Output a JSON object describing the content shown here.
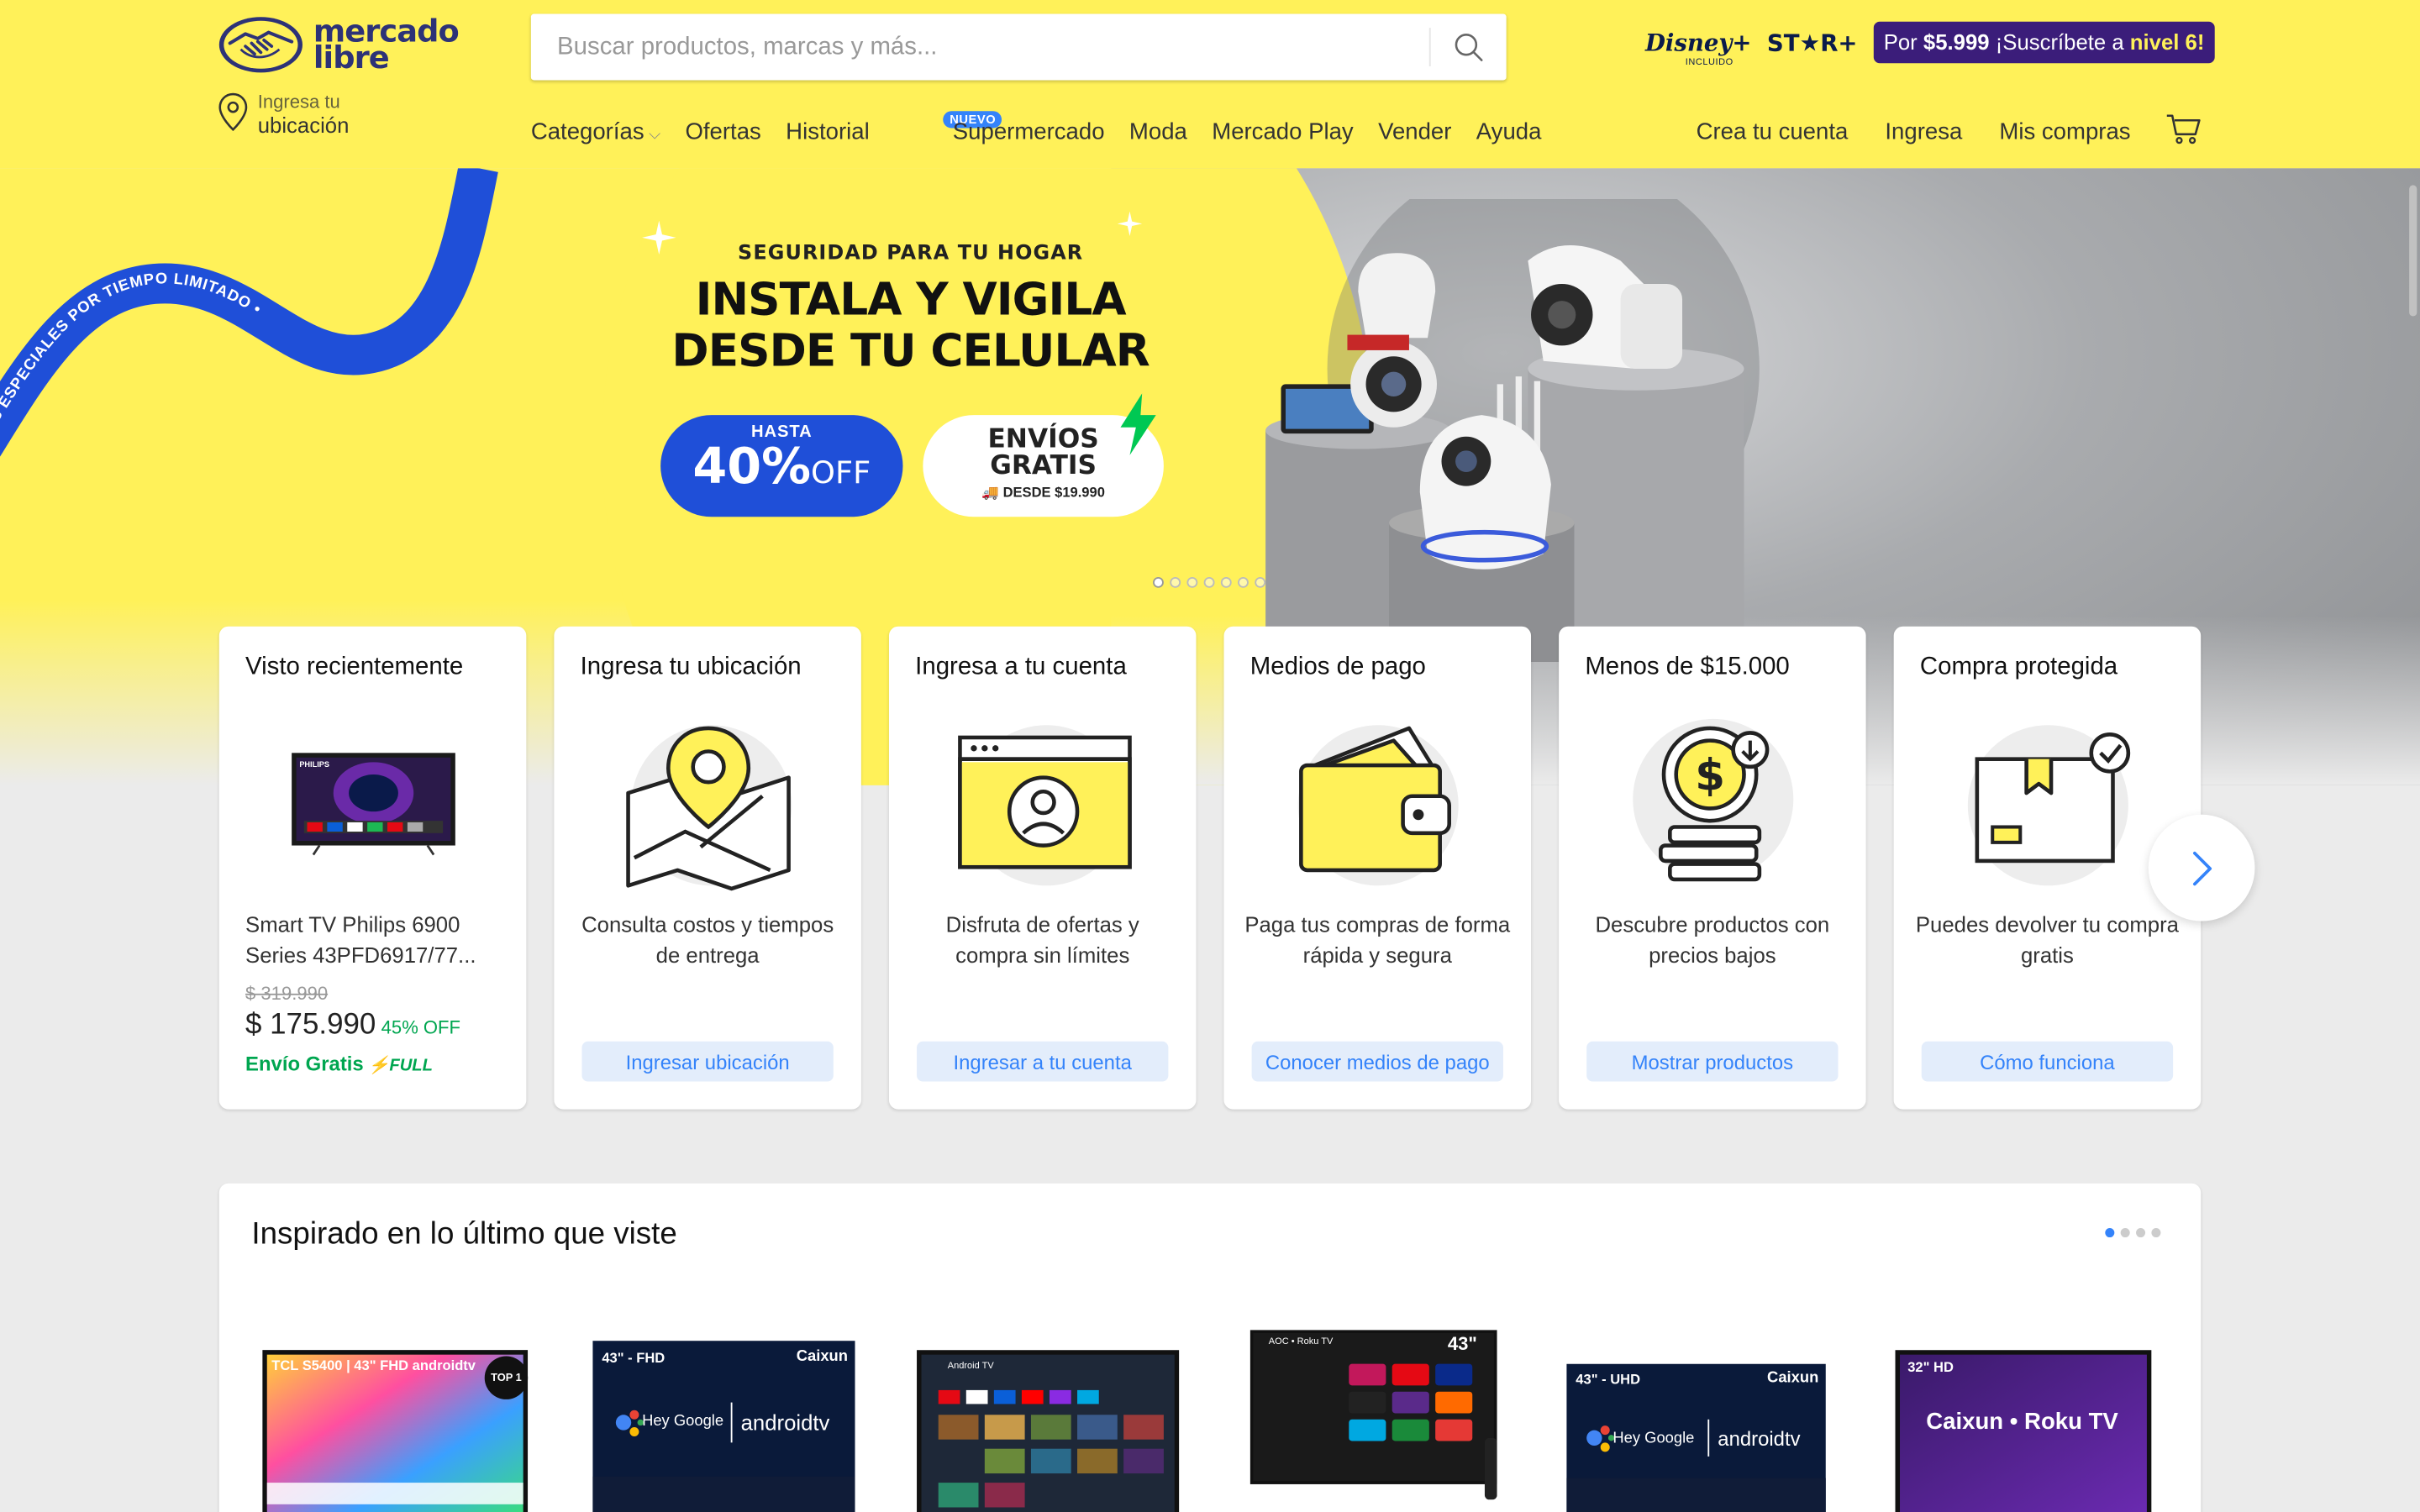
{
  "header": {
    "logo_line1": "mercado",
    "logo_line2": "libre",
    "location_line1": "Ingresa tu",
    "location_line2": "ubicación",
    "search_placeholder": "Buscar productos, marcas y más...",
    "promo": {
      "disney": "Disney+",
      "disney_sub": "INCLUIDO",
      "star": "ST★R+",
      "subscribe_prefix": "Por",
      "subscribe_price": "$5.999",
      "subscribe_text": "¡Suscríbete a",
      "subscribe_level": "nivel 6!"
    },
    "nav": [
      {
        "label": "Categorías"
      },
      {
        "label": "Ofertas"
      },
      {
        "label": "Historial"
      },
      {
        "label": "Supermercado",
        "badge": "NUEVO"
      },
      {
        "label": "Moda"
      },
      {
        "label": "Mercado Play"
      },
      {
        "label": "Vender"
      },
      {
        "label": "Ayuda"
      }
    ],
    "user_nav": [
      {
        "label": "Crea tu cuenta"
      },
      {
        "label": "Ingresa"
      },
      {
        "label": "Mis compras"
      }
    ]
  },
  "hero": {
    "ribbon_text": "OFERTAS ESPECIALES POR TIEMPO LIMITADO •",
    "kicker": "SEGURIDAD PARA TU HOGAR",
    "title_line1": "INSTALA Y VIGILA",
    "title_line2": "DESDE TU CELULAR",
    "discount_prefix": "HASTA",
    "discount_value": "40%",
    "discount_suffix": "OFF",
    "shipping_line1": "ENVÍOS",
    "shipping_line2": "GRATIS",
    "shipping_line3": "DESDE $19.990",
    "slide_count": 7,
    "active_slide": 0
  },
  "cards": [
    {
      "title": "Visto recientemente",
      "product_title": "Smart TV Philips 6900 Series 43PFD6917/77...",
      "old_price": "$ 319.990",
      "price": "$ 175.990",
      "discount": "45% OFF",
      "shipping": "Envío Gratis",
      "shipping_badge": "FULL"
    },
    {
      "title": "Ingresa tu ubicación",
      "description": "Consulta costos y tiempos de entrega",
      "cta": "Ingresar ubicación",
      "icon": "map-pin-icon"
    },
    {
      "title": "Ingresa a tu cuenta",
      "description": "Disfruta de ofertas y compra sin límites",
      "cta": "Ingresar a tu cuenta",
      "icon": "user-window-icon"
    },
    {
      "title": "Medios de pago",
      "description": "Paga tus compras de forma rápida y segura",
      "cta": "Conocer medios de pago",
      "icon": "wallet-icon"
    },
    {
      "title": "Menos de $15.000",
      "description": "Descubre productos con precios bajos",
      "cta": "Mostrar productos",
      "icon": "coins-icon"
    },
    {
      "title": "Compra protegida",
      "description": "Puedes devolver tu compra gratis",
      "cta": "Cómo funciona",
      "icon": "box-check-icon"
    }
  ],
  "inspired": {
    "title": "Inspirado en lo último que viste",
    "page_count": 4,
    "active_page": 0,
    "products": [
      {
        "label": "TCL S5400 | 43\" FHD androidtv",
        "badge": "TOP 1"
      },
      {
        "label": "43\" - FHD",
        "brand": "Caixun",
        "os": "androidtv",
        "assistant": "Hey Google"
      },
      {
        "label": "Android TV"
      },
      {
        "label": "43\"",
        "brand": "AOC • Roku TV"
      },
      {
        "label": "43\" - UHD",
        "brand": "Caixun",
        "os": "androidtv",
        "assistant": "Hey Google"
      },
      {
        "label": "32\" HD",
        "brand": "Caixun • Roku TV"
      }
    ]
  },
  "colors": {
    "brand_yellow": "#fff159",
    "accent_blue": "#3483fa",
    "success_green": "#00a650",
    "logo_navy": "#2d3277"
  }
}
